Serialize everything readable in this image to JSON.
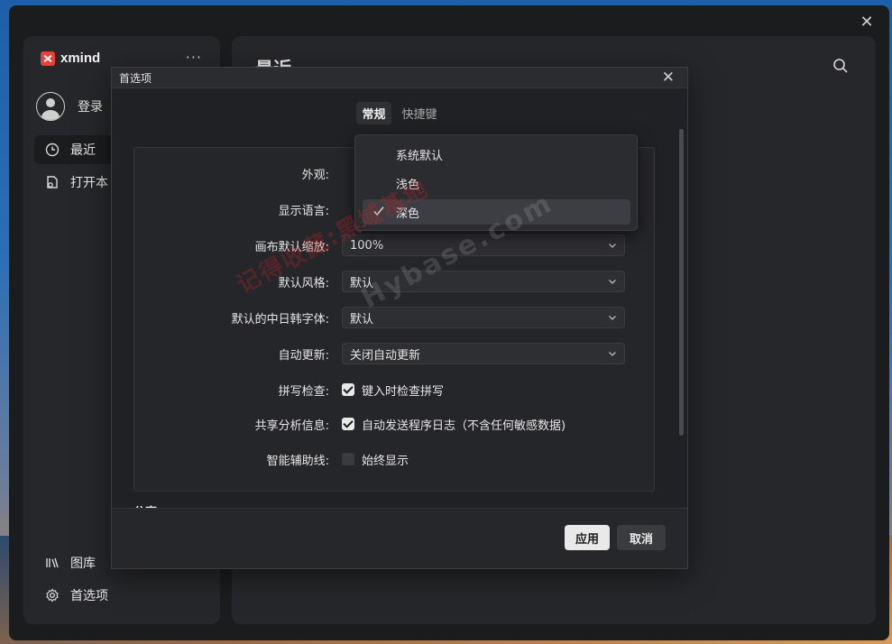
{
  "sidebar": {
    "brand": "xmind",
    "more": "···",
    "login": "登录",
    "items": [
      {
        "label": "最近",
        "icon": "clock-icon"
      },
      {
        "label": "打开本",
        "icon": "open-file-icon"
      }
    ],
    "bottom_items": [
      {
        "label": "图库",
        "icon": "library-icon"
      },
      {
        "label": "首选项",
        "icon": "gear-icon"
      }
    ]
  },
  "main": {
    "title": "最近"
  },
  "dialog": {
    "title": "首选项",
    "tabs": [
      "常规",
      "快捷键"
    ],
    "rows": [
      {
        "label": "外观:"
      },
      {
        "label": "显示语言:"
      },
      {
        "label": "画布默认缩放:",
        "value": "100%"
      },
      {
        "label": "默认风格:",
        "value": "默认"
      },
      {
        "label": "默认的中日韩字体:",
        "value": "默认"
      },
      {
        "label": "自动更新:",
        "value": "关闭自动更新"
      },
      {
        "label": "拼写检查:",
        "checkbox": "键入时检查拼写",
        "checked": true
      },
      {
        "label": "共享分析信息:",
        "checkbox": "自动发送程序日志（不含任何敏感数据)",
        "checked": true
      },
      {
        "label": "智能辅助线:",
        "checkbox": "始终显示",
        "checked": false
      }
    ],
    "next_section": "分享",
    "apply": "应用",
    "cancel": "取消"
  },
  "dropdown": {
    "options": [
      "系统默认",
      "浅色",
      "深色"
    ],
    "selected": "深色"
  },
  "watermark": {
    "text1": "记得收藏:黑域基地",
    "text2": "Hybase.com"
  },
  "colors": {
    "dialog_bg": "#202124",
    "sidebar_bg": "#26272a",
    "accent_button": "#e9e9e9",
    "logo": "#e8403a"
  }
}
